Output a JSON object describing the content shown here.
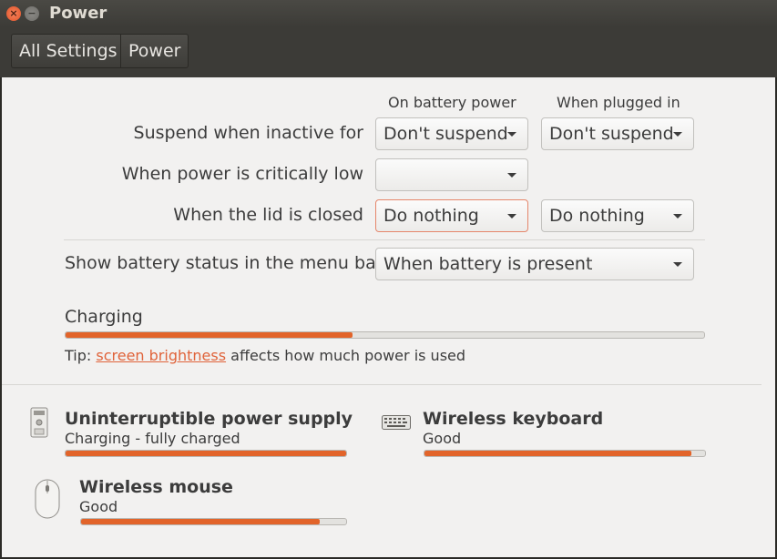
{
  "window": {
    "title": "Power",
    "close_glyph": "×",
    "min_glyph": "−"
  },
  "breadcrumb": {
    "all_settings": "All Settings",
    "power": "Power"
  },
  "columns": {
    "battery": "On battery power",
    "plugged": "When plugged in"
  },
  "rows": {
    "suspend": {
      "label": "Suspend when inactive for",
      "battery": "Don't suspend",
      "plugged": "Don't suspend"
    },
    "critical": {
      "label": "When power is critically low",
      "battery": ""
    },
    "lid": {
      "label": "When the lid is closed",
      "battery": "Do nothing",
      "plugged": "Do nothing"
    },
    "battery_status": {
      "label": "Show battery status in the menu bar",
      "value": "When battery is present"
    }
  },
  "charging": {
    "label": "Charging",
    "level": 0.45
  },
  "tip": {
    "prefix": "Tip: ",
    "link": "screen brightness",
    "suffix": " affects how much power is used"
  },
  "devices": {
    "ups": {
      "name": "Uninterruptible power supply",
      "status": "Charging - fully charged",
      "level": 1.0,
      "icon": "ups-icon"
    },
    "keyboard": {
      "name": "Wireless keyboard",
      "status": "Good",
      "level": 0.95,
      "icon": "keyboard-icon"
    },
    "mouse": {
      "name": "Wireless mouse",
      "status": "Good",
      "level": 0.9,
      "icon": "mouse-icon"
    }
  },
  "colors": {
    "accent": "#e2642a",
    "link": "#e0633a",
    "background": "#f2f1f0",
    "titlebar": "#3c3b37"
  }
}
